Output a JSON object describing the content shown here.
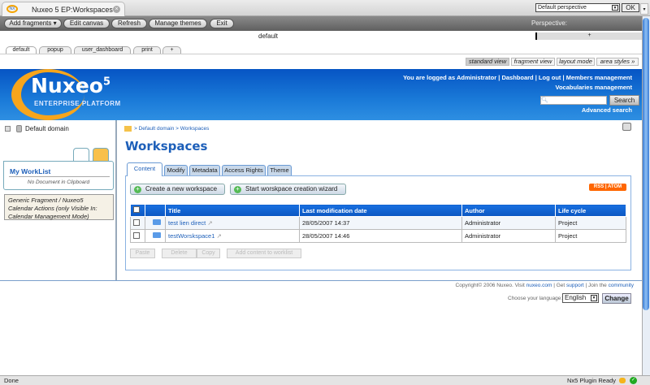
{
  "browser": {
    "tab_title": "Nuxeo 5 EP:Workspaces",
    "logo": "NX"
  },
  "toolbar": {
    "add_fragments": "Add fragments ▾",
    "edit_canvas": "Edit canvas",
    "refresh": "Refresh",
    "manage_themes": "Manage themes",
    "exit": "Exit",
    "perspective_label": "Perspective:",
    "perspective_value": "Default perspective",
    "ok": "OK"
  },
  "canvas": {
    "name": "default",
    "plus": "+"
  },
  "page_tabs": [
    "default",
    "popup",
    "user_dashboard",
    "print",
    "+"
  ],
  "view_modes": [
    "standard view",
    "fragment view",
    "layout mode",
    "area styles »"
  ],
  "header": {
    "logo": "Nuxeo",
    "logo_sup": "5",
    "logo_sub": "ENTERPRISE PLATFORM",
    "logged": "You are logged as Administrator",
    "dashboard": "Dashboard",
    "logout": "Log out",
    "members": "Members management",
    "vocabularies": "Vocabularies management",
    "search_btn": "Search",
    "advanced": "Advanced search",
    "sep": "|"
  },
  "sidebar": {
    "domain": "Default domain",
    "worklist_title": "My WorkList",
    "worklist_empty": "No Document in Clipboard",
    "generic": "Generic Fragment / Nuxeo5 Calendar Actions (only Visible In: Calendar Management Mode)"
  },
  "main": {
    "breadcrumb": "> Default domain > Workspaces",
    "title": "Workspaces",
    "tabs": [
      "Content",
      "Modify",
      "Metadata",
      "Access Rights",
      "Theme"
    ],
    "create_btn": "Create a new workspace",
    "wizard_btn": "Start worskpace creation wizard",
    "rss": "RSS | ATOM",
    "columns": [
      "Title",
      "Last modification date",
      "Author",
      "Life cycle"
    ],
    "rows": [
      {
        "title": "test lien direct",
        "date": "28/05/2007 14:37",
        "author": "Administrator",
        "life": "Project"
      },
      {
        "title": "testWorskspace1",
        "date": "28/05/2007 14:46",
        "author": "Administrator",
        "life": "Project"
      }
    ],
    "bottom_buttons": [
      "Paste",
      "Delete",
      "Copy",
      "Add content to worklist"
    ]
  },
  "footer": {
    "copyright": "Copyright© 2006 Nuxeo. Visit ",
    "nuxeo_link": "nuxeo.com",
    "get": " | Get ",
    "support": "support",
    "join": " | Join the ",
    "community": "community",
    "lang_label": "Choose your language:",
    "lang_value": "English",
    "change": "Change"
  },
  "status": {
    "left": "Done",
    "right": "Nx5 Plugin Ready"
  }
}
